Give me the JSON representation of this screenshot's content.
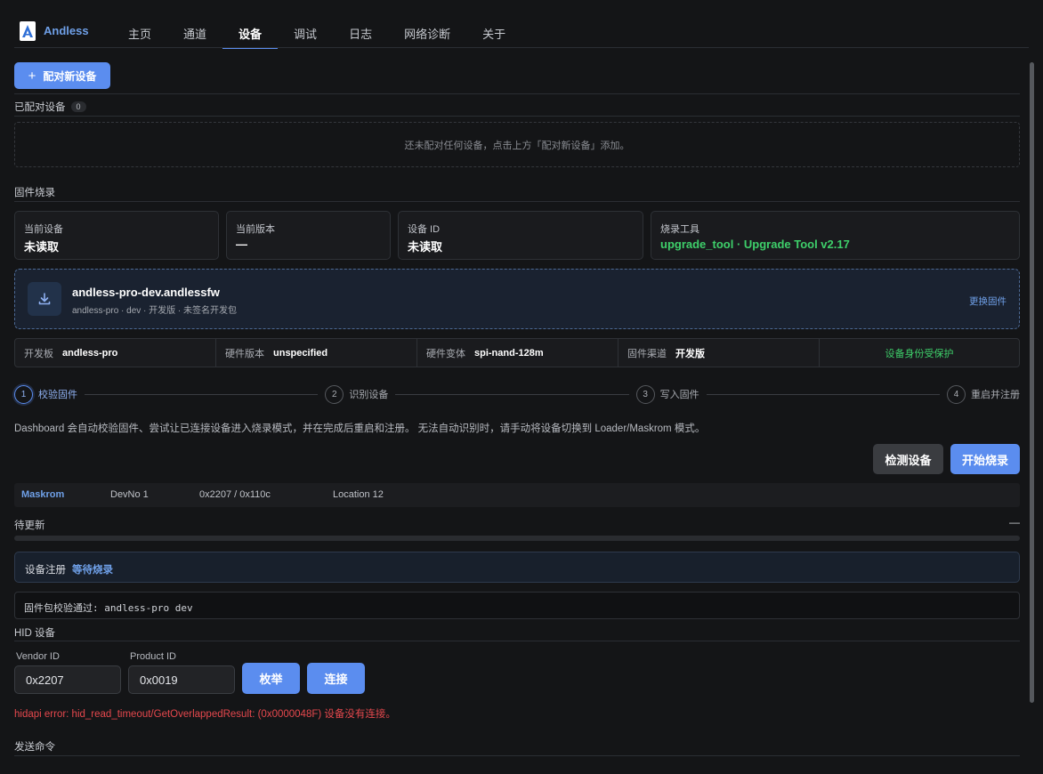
{
  "app": {
    "name": "Andless"
  },
  "nav": {
    "items": [
      {
        "label": "主页",
        "active": false
      },
      {
        "label": "通道",
        "active": false
      },
      {
        "label": "设备",
        "active": true
      },
      {
        "label": "调试",
        "active": false
      },
      {
        "label": "日志",
        "active": false
      },
      {
        "label": "网络诊断",
        "active": false
      },
      {
        "label": "关于",
        "active": false
      }
    ]
  },
  "paired": {
    "add_button": "配对新设备",
    "title": "已配对设备",
    "count": "0",
    "empty_text": "还未配对任何设备，点击上方「配对新设备」添加。"
  },
  "firmware": {
    "title": "固件烧录",
    "cards": [
      {
        "label": "当前设备",
        "value": "未读取",
        "accent": ""
      },
      {
        "label": "当前版本",
        "value": "—",
        "accent": ""
      },
      {
        "label": "设备 ID",
        "value": "未读取",
        "accent": ""
      },
      {
        "label": "烧录工具",
        "value": "upgrade_tool · Upgrade Tool v2.17",
        "accent": "#3ecf6a"
      }
    ],
    "file": {
      "name": "andless-pro-dev.andlessfw",
      "meta": "andless-pro · dev · 开发版 · 未签名开发包",
      "change_label": "更换固件",
      "icon": "download-icon"
    },
    "meta_row": {
      "board_label": "开发板",
      "board_value": "andless-pro",
      "hw_label": "硬件版本",
      "hw_value": "unspecified",
      "variant_label": "硬件变体",
      "variant_value": "spi-nand-128m",
      "channel_label": "固件渠道",
      "channel_value": "开发版",
      "protect_text": "设备身份受保护"
    },
    "steps": [
      {
        "num": "1",
        "label": "校验固件",
        "active": true
      },
      {
        "num": "2",
        "label": "识别设备",
        "active": false
      },
      {
        "num": "3",
        "label": "写入固件",
        "active": false
      },
      {
        "num": "4",
        "label": "重启并注册",
        "active": false
      }
    ],
    "description": "Dashboard 会自动校验固件、尝试让已连接设备进入烧录模式，并在完成后重启和注册。 无法自动识别时，请手动将设备切换到 Loader/Maskrom 模式。",
    "detect_button": "检测设备",
    "start_button": "开始烧录",
    "device_row": {
      "mode": "Maskrom",
      "devno": "DevNo 1",
      "ids": "0x2207 / 0x110c",
      "location": "Location 12"
    },
    "pending": {
      "label": "待更新",
      "dash": "—",
      "progress": 0
    },
    "status": {
      "label": "设备注册",
      "value": "等待烧录"
    },
    "log": "固件包校验通过: andless-pro dev"
  },
  "hid": {
    "title": "HID 设备",
    "vendor_label": "Vendor ID",
    "vendor_value": "0x2207",
    "product_label": "Product ID",
    "product_value": "0x0019",
    "enumerate_button": "枚举",
    "connect_button": "连接",
    "error": "hidapi error: hid_read_timeout/GetOverlappedResult: (0x0000048F) 设备没有连接。"
  },
  "send": {
    "title": "发送命令"
  },
  "colors": {
    "accent": "#5b8def",
    "success": "#3ecf6a",
    "error": "#e5484d",
    "background": "#141517"
  }
}
